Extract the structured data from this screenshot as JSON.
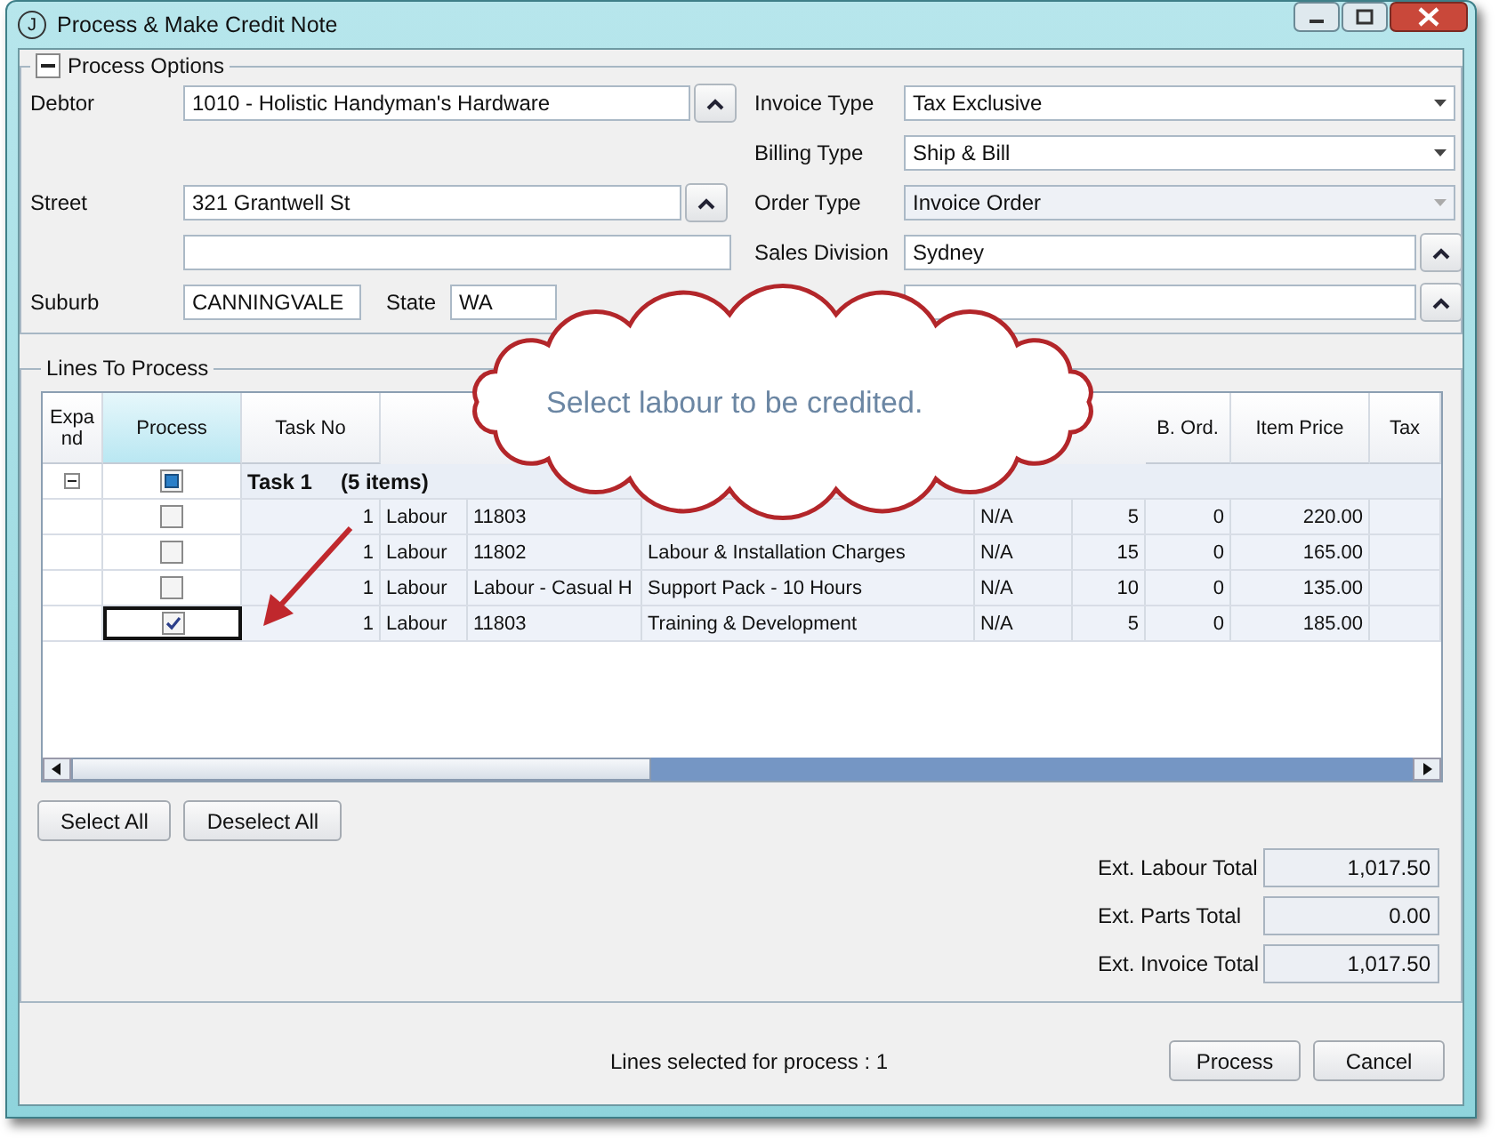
{
  "window": {
    "logo_letter": "J",
    "title": "Process & Make Credit Note"
  },
  "process_options": {
    "title": "Process Options",
    "expanded": true,
    "debtor": {
      "label": "Debtor",
      "value": "1010 - Holistic Handyman's Hardware"
    },
    "street": {
      "label": "Street",
      "value": "321 Grantwell St"
    },
    "suburb": {
      "label": "Suburb",
      "value": "CANNINGVALE"
    },
    "state": {
      "label": "State",
      "value": "WA"
    },
    "invoice_type": {
      "label": "Invoice Type",
      "value": "Tax Exclusive",
      "disabled": false
    },
    "billing_type": {
      "label": "Billing Type",
      "value": "Ship & Bill",
      "disabled": false
    },
    "order_type": {
      "label": "Order Type",
      "value": "Invoice Order",
      "disabled": true
    },
    "sales_division": {
      "label": "Sales Division",
      "value": "Sydney"
    }
  },
  "lines": {
    "title": "Lines To Process",
    "headers": {
      "expand": "Expand",
      "process": "Process",
      "task_no": "Task No",
      "back_order": "B. Ord.",
      "item_price": "Item Price",
      "tax": "Tax"
    },
    "group": {
      "label": "Task 1",
      "count": "(5 items)",
      "expanded": true,
      "process_mixed": true
    },
    "rows": [
      {
        "task_no": "1",
        "type": "Labour",
        "code": "11803",
        "billing": "N/A",
        "qty": "5",
        "back_order": "0",
        "item_price": "220.00",
        "process": false,
        "selected": false
      },
      {
        "task_no": "1",
        "type": "Labour",
        "code": "11802",
        "description": "Labour & Installation Charges",
        "billing": "N/A",
        "qty": "15",
        "back_order": "0",
        "item_price": "165.00",
        "process": false,
        "selected": false
      },
      {
        "task_no": "1",
        "type": "Labour",
        "code": "Labour - Casual H",
        "description": "Support Pack - 10 Hours",
        "billing": "N/A",
        "qty": "10",
        "back_order": "0",
        "item_price": "135.00",
        "process": false,
        "selected": false
      },
      {
        "task_no": "1",
        "type": "Labour",
        "code": "11803",
        "description": "Training & Development",
        "billing": "N/A",
        "qty": "5",
        "back_order": "0",
        "item_price": "185.00",
        "process": true,
        "selected": true
      }
    ]
  },
  "buttons": {
    "select_all": "Select All",
    "deselect_all": "Deselect All"
  },
  "totals": [
    {
      "label": "Ext. Labour Total",
      "value": "1,017.50"
    },
    {
      "label": "Ext. Parts Total",
      "value": "0.00"
    },
    {
      "label": "Ext. Invoice Total",
      "value": "1,017.50"
    }
  ],
  "status": "Lines selected for process : 1",
  "actions": [
    "Process",
    "Cancel"
  ],
  "callout": {
    "text": "Select labour to be credited."
  }
}
